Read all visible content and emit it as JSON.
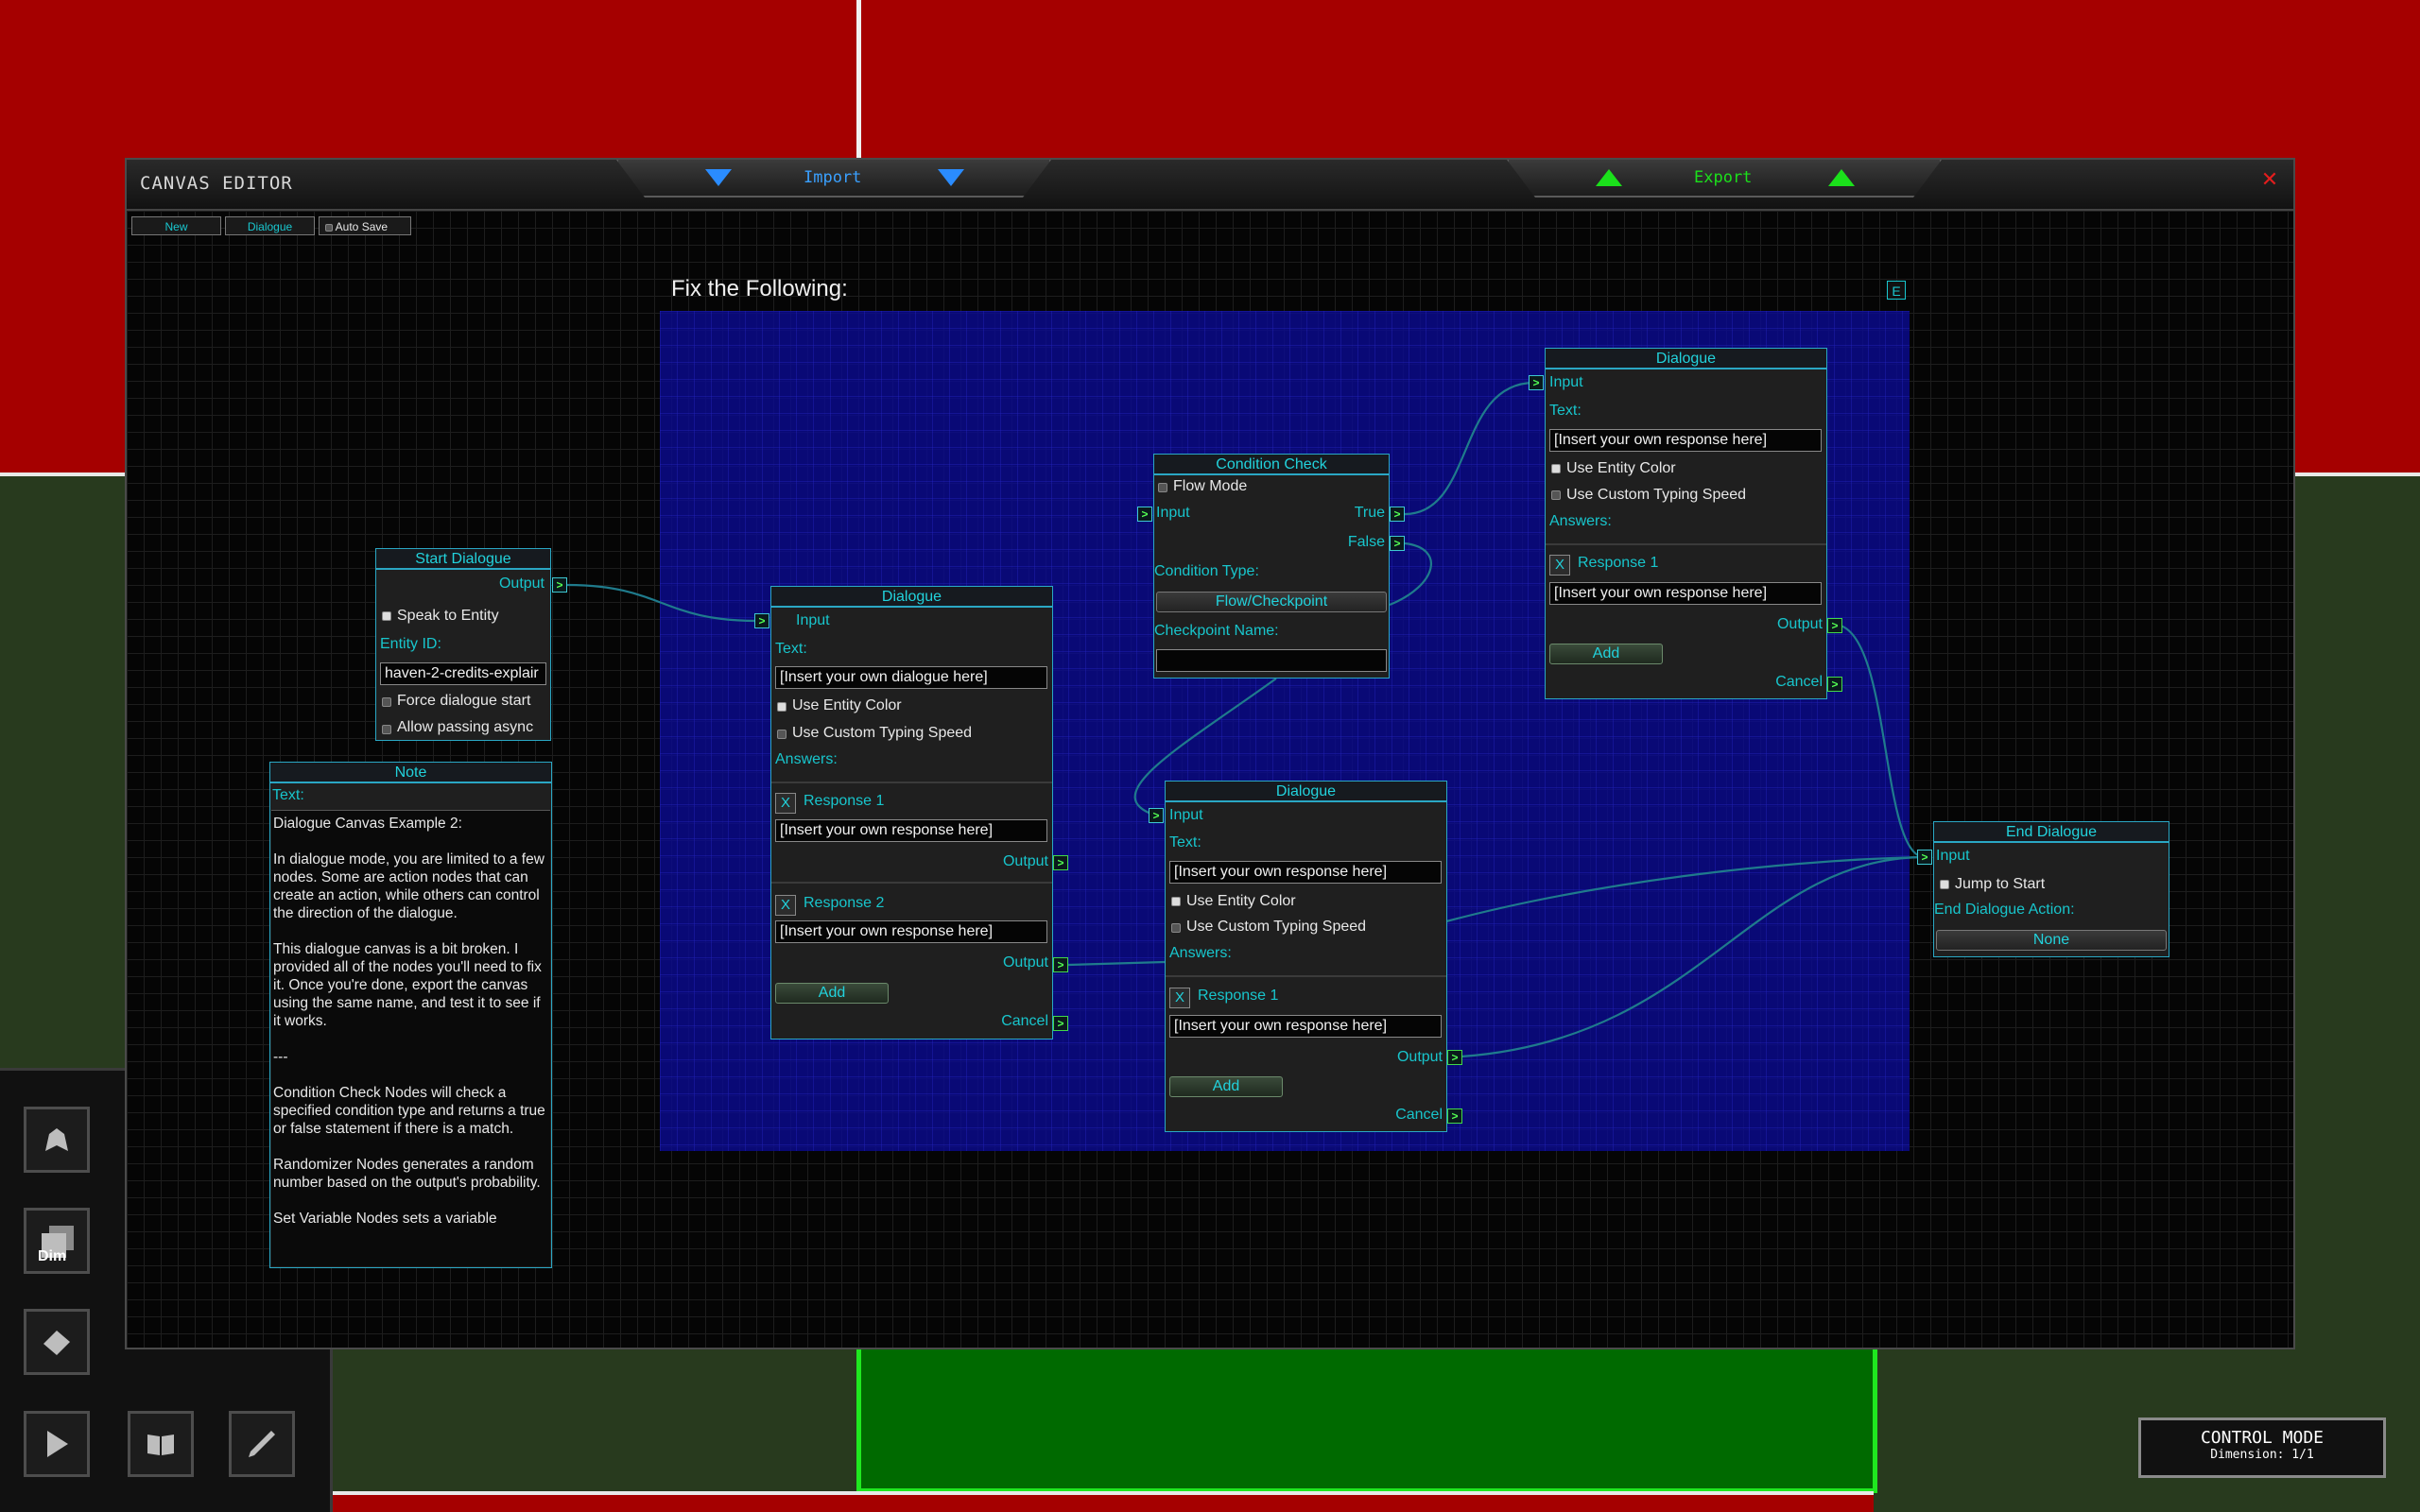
{
  "window": {
    "title": "CANVAS EDITOR",
    "import_label": "Import",
    "export_label": "Export",
    "close_glyph": "✕"
  },
  "toolbar": {
    "new_label": "New",
    "mode_label": "Dialogue",
    "autosave_label": "Auto Save",
    "autosave_checked": false
  },
  "group": {
    "title": "Fix the Following:",
    "edit_label": "E",
    "color": "#0a0a96"
  },
  "nodes": {
    "start": {
      "title": "Start Dialogue",
      "output": "Output",
      "speak_to_entity": "Speak to Entity",
      "entity_id_label": "Entity ID:",
      "entity_id_value": "haven-2-credits-explair",
      "force_start": "Force dialogue start",
      "allow_async": "Allow passing async"
    },
    "note": {
      "title": "Note",
      "text_label": "Text:",
      "body": "Dialogue Canvas Example 2:\n\nIn dialogue mode, you are limited to a few nodes. Some are action nodes that can create an action, while others can control the direction of the dialogue.\n\nThis dialogue canvas is a bit broken. I provided all of the nodes you'll need to fix it. Once you're done, export the canvas using the same name, and test it to see if it works.\n\n---\n\nCondition Check Nodes will check a specified condition type and returns a true or false statement if there is a match.\n\nRandomizer Nodes generates a random number based on the output's probability.\n\nSet Variable Nodes sets a variable"
    },
    "dialogue1": {
      "title": "Dialogue",
      "input": "Input",
      "text_label": "Text:",
      "text_value": "[Insert your own dialogue here]",
      "entity_color": "Use Entity Color",
      "typing_speed": "Use Custom Typing Speed",
      "answers": "Answers:",
      "responses": [
        {
          "x": "X",
          "label": "Response 1",
          "value": "[Insert your own response here]",
          "output": "Output"
        },
        {
          "x": "X",
          "label": "Response 2",
          "value": "[Insert your own response here]",
          "output": "Output"
        }
      ],
      "add": "Add",
      "cancel": "Cancel"
    },
    "condition": {
      "title": "Condition Check",
      "flow_mode": "Flow Mode",
      "input": "Input",
      "true_label": "True",
      "false_label": "False",
      "type_label": "Condition Type:",
      "type_value": "Flow/Checkpoint",
      "checkpoint_label": "Checkpoint Name:",
      "checkpoint_value": ""
    },
    "dialogue2": {
      "title": "Dialogue",
      "input": "Input",
      "text_label": "Text:",
      "text_value": "[Insert your own response here]",
      "entity_color": "Use Entity Color",
      "typing_speed": "Use Custom Typing Speed",
      "answers": "Answers:",
      "responses": [
        {
          "x": "X",
          "label": "Response 1",
          "value": "[Insert your own response here]",
          "output": "Output"
        }
      ],
      "add": "Add",
      "cancel": "Cancel"
    },
    "dialogue3": {
      "title": "Dialogue",
      "input": "Input",
      "text_label": "Text:",
      "text_value": "[Insert your own response here]",
      "entity_color": "Use Entity Color",
      "typing_speed": "Use Custom Typing Speed",
      "answers": "Answers:",
      "responses": [
        {
          "x": "X",
          "label": "Response 1",
          "value": "[Insert your own response here]",
          "output": "Output"
        }
      ],
      "add": "Add",
      "cancel": "Cancel"
    },
    "end": {
      "title": "End Dialogue",
      "input": "Input",
      "jump_to_start": "Jump to Start",
      "action_label": "End Dialogue Action:",
      "action_value": "None"
    }
  },
  "knob_glyph": ">",
  "left_toolbar": {
    "dim_label": "Dim",
    "icons": [
      "ship-icon",
      "dim-icon",
      "eraser-icon",
      "play-icon",
      "book-icon",
      "pen-icon"
    ]
  },
  "control_mode": {
    "title": "CONTROL MODE",
    "dimension": "Dimension: 1/1"
  }
}
